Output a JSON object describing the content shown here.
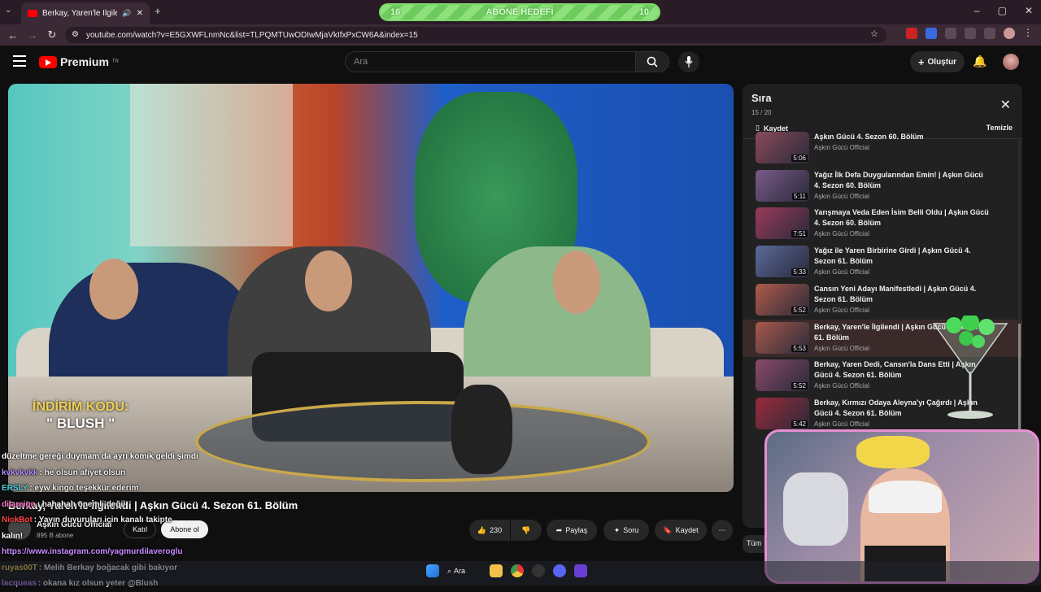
{
  "browser": {
    "tab_title": "Berkay, Yaren'le İlgilendi | A",
    "url": "youtube.com/watch?v=E5GXWFLnmNc&list=TLPQMTUwODIwMjaVkIfxPxCW6A&index=15",
    "window_controls": [
      "–",
      "▢",
      "✕"
    ]
  },
  "goal_bar": {
    "left": "16",
    "title": "ABONE HEDEFİ",
    "right": "10"
  },
  "header": {
    "logo": "Premium",
    "logo_sup": "TR",
    "search_placeholder": "Ara",
    "create_label": "Oluştur"
  },
  "video": {
    "promo_line1": "İNDİRİM KODU:",
    "promo_code": "\" BLUSH \"",
    "title": "Berkay, Yaren'le İlgilendi | Aşkın Gücü 4. Sezon 61. Bölüm"
  },
  "channel": {
    "name": "Aşkın Gücü Official",
    "subs": "895 B abone",
    "join_label": "Katıl",
    "subscribe_label": "Abone ol"
  },
  "actions": {
    "likes": "230",
    "share": "Paylaş",
    "ask": "Soru",
    "save": "Kaydet"
  },
  "chat": [
    {
      "user": "",
      "text": "düzeltme gereği duymam da ayrı komik geldi şimdi",
      "color": "#ffffff"
    },
    {
      "user": "kvkvkvkk",
      "text": ": he olsun afiyet olsun",
      "color": "#b48cff"
    },
    {
      "user": "ERSLY",
      "text": ": eyw kingo teşekkür ederim",
      "color": "#4fd0e0"
    },
    {
      "user": "dilareign",
      "text": ": hahahah önemli değil",
      "color": "#ff77c8"
    },
    {
      "user": "NickBot",
      "text": ": Yayın duyuruları için kanalı takipte",
      "color": "#ff4040"
    },
    {
      "user": "",
      "text": "kalın!",
      "color": "#ffffff"
    },
    {
      "user": "",
      "text": "https://www.instagram.com/yagmurdilaveroglu",
      "color": "#c58aff"
    },
    {
      "user": "ruyas00T",
      "text": ": Melih Berkay boğacak gibi bakıyor",
      "color": "#ffd24a"
    },
    {
      "user": "lacqueas",
      "text": ": okana kız olsun yeter @Blush",
      "color": "#c58aff"
    }
  ],
  "playlist": {
    "title": "Sıra",
    "count": "15 / 20",
    "save_label": "Kaydet",
    "clear_label": "Temizle",
    "items": [
      {
        "title": "Aşkın Gücü 4. Sezon 60. Bölüm",
        "channel": "Aşkın Gücü Official",
        "duration": "5:06",
        "color": "#8a4a5a"
      },
      {
        "title": "Yağız İlk Defa Duygularından Emin! | Aşkın Gücü 4. Sezon 60. Bölüm",
        "channel": "Aşkın Gücü Official",
        "duration": "5:11",
        "color": "#7a5a8a"
      },
      {
        "title": "Yarışmaya Veda Eden İsim Belli Oldu | Aşkın Gücü 4. Sezon 60. Bölüm",
        "channel": "Aşkın Gücü Official",
        "duration": "7:51",
        "color": "#9a3a5a"
      },
      {
        "title": "Yağız ile Yaren Birbirine Girdi | Aşkın Gücü 4. Sezon 61. Bölüm",
        "channel": "Aşkın Gücü Official",
        "duration": "5:33",
        "color": "#5a6a9a"
      },
      {
        "title": "Cansın Yeni Adayı Manifestledi | Aşkın Gücü 4. Sezon 61. Bölüm",
        "channel": "Aşkın Gücü Official",
        "duration": "5:52",
        "color": "#b05a4a"
      },
      {
        "title": "Berkay, Yaren'le İlgilendi | Aşkın Gücü 4. Sezon 61. Bölüm",
        "channel": "Aşkın Gücü Official",
        "duration": "5:53",
        "color": "#a85a4a"
      },
      {
        "title": "Berkay, Yaren Dedi, Cansın'la Dans Etti | Aşkın Gücü 4. Sezon 61. Bölüm",
        "channel": "Aşkın Gücü Official",
        "duration": "5:52",
        "color": "#8a4a6a"
      },
      {
        "title": "Berkay, Kırmızı Odaya Aleyna'yı Çağırdı | Aşkın Gücü 4. Sezon 61. Bölüm",
        "channel": "Aşkın Gücü Official",
        "duration": "5:42",
        "color": "#9a2a3a"
      }
    ]
  },
  "taskbar": {
    "search_label": "Ara"
  }
}
